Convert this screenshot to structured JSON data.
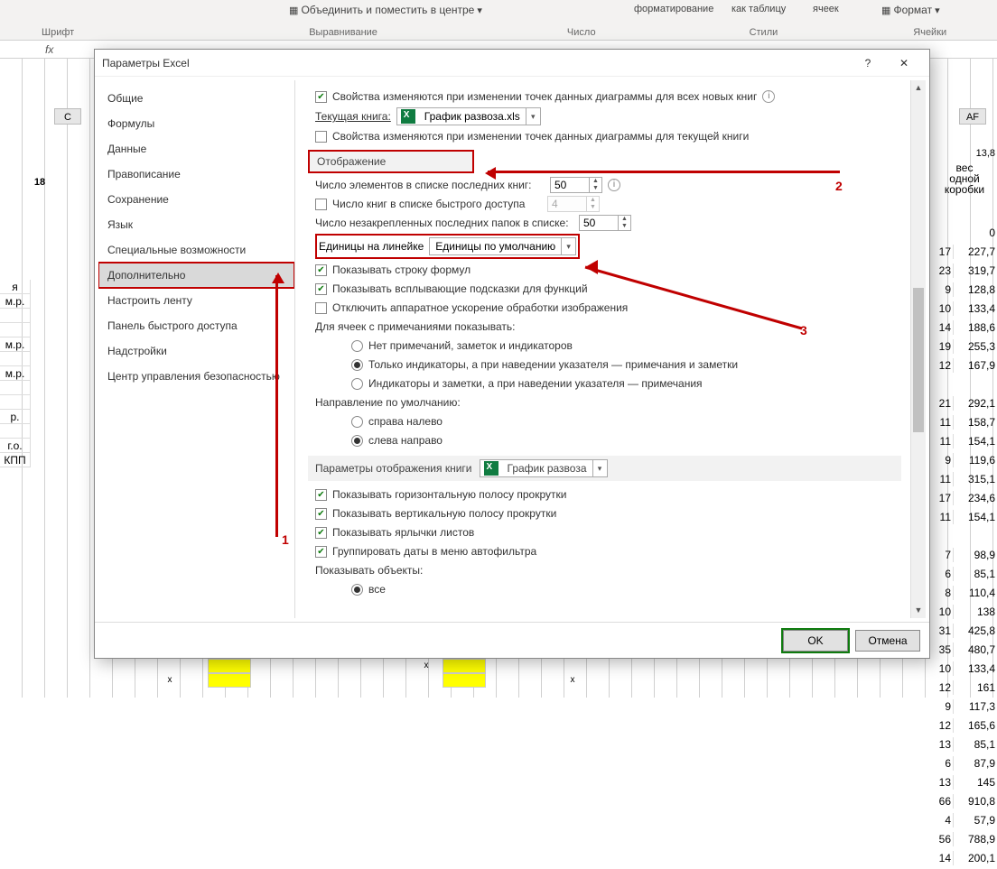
{
  "ribbon": {
    "merge_center": "Объединить и поместить в центре",
    "groups": [
      "Шрифт",
      "Выравнивание",
      "Число",
      "Стили",
      "Ячейки"
    ],
    "cond_format": "форматирование",
    "as_table": "как таблицу",
    "cells_style": "ячеек",
    "format": "Формат"
  },
  "formula_fx": "fx",
  "bg": {
    "col_c": "C",
    "col_af": "AF",
    "cell18": "18",
    "rhead1": "вес",
    "rhead2": "одной",
    "rhead3": "коробки",
    "topright": "13,8",
    "side_labels": [
      "я",
      "м.р.",
      "",
      "",
      "м.р.",
      "",
      "м.р.",
      "",
      "",
      "р.",
      "",
      "г.о.",
      "КПП"
    ],
    "side_x": [
      "x",
      "",
      "",
      "",
      "",
      "",
      "",
      "",
      "",
      "",
      "",
      "x",
      "",
      "x"
    ],
    "right_rows": [
      [
        "",
        "0"
      ],
      [
        "17",
        "227,7"
      ],
      [
        "23",
        "319,7"
      ],
      [
        "9",
        "128,8"
      ],
      [
        "10",
        "133,4"
      ],
      [
        "14",
        "188,6"
      ],
      [
        "19",
        "255,3"
      ],
      [
        "12",
        "167,9"
      ],
      [
        "",
        ""
      ],
      [
        "21",
        "292,1"
      ],
      [
        "11",
        "158,7"
      ],
      [
        "11",
        "154,1"
      ],
      [
        "9",
        "119,6"
      ],
      [
        "11",
        "315,1"
      ],
      [
        "17",
        "234,6"
      ],
      [
        "11",
        "154,1"
      ],
      [
        "",
        ""
      ],
      [
        "7",
        "98,9"
      ],
      [
        "6",
        "85,1"
      ],
      [
        "8",
        "110,4"
      ],
      [
        "10",
        "138"
      ],
      [
        "31",
        "425,8"
      ],
      [
        "35",
        "480,7"
      ],
      [
        "10",
        "133,4"
      ],
      [
        "12",
        "161"
      ],
      [
        "9",
        "117,3"
      ],
      [
        "12",
        "165,6"
      ],
      [
        "13",
        "85,1"
      ],
      [
        "6",
        "87,9"
      ],
      [
        "13",
        "145"
      ],
      [
        "66",
        "910,8"
      ],
      [
        "4",
        "57,9"
      ],
      [
        "56",
        "788,9"
      ],
      [
        "14",
        "200,1"
      ]
    ],
    "bottom_x": [
      "x",
      "x",
      "x"
    ]
  },
  "dialog": {
    "title": "Параметры Excel",
    "help": "?",
    "close": "✕",
    "nav": [
      "Общие",
      "Формулы",
      "Данные",
      "Правописание",
      "Сохранение",
      "Язык",
      "Специальные возможности",
      "Дополнительно",
      "Настроить ленту",
      "Панель быстрого доступа",
      "Надстройки",
      "Центр управления безопасностью"
    ],
    "nav_selected": "Дополнительно",
    "content": {
      "prop_all": "Свойства изменяются при изменении точек данных диаграммы для всех новых книг",
      "curbook_lbl": "Текущая книга:",
      "curbook_val": "График развоза.xls",
      "prop_cur": "Свойства изменяются при изменении точек данных диаграммы для текущей книги",
      "sect_display": "Отображение",
      "recent_docs_lbl": "Число элементов в списке последних книг:",
      "recent_docs_val": "50",
      "quick_books_lbl": "Число книг в списке быстрого доступа",
      "quick_books_val": "4",
      "unpinned_lbl": "Число незакрепленных последних папок в списке:",
      "unpinned_val": "50",
      "ruler_lbl": "Единицы на линейке",
      "ruler_val": "Единицы по умолчанию",
      "show_formula": "Показывать строку формул",
      "show_tooltips": "Показывать всплывающие подсказки для функций",
      "hw_accel": "Отключить аппаратное ускорение обработки изображения",
      "comments_head": "Для ячеек с примечаниями показывать:",
      "c_opt1": "Нет примечаний, заметок и индикаторов",
      "c_opt2": "Только индикаторы, а при наведении указателя — примечания и заметки",
      "c_opt3": "Индикаторы и заметки, а при наведении указателя — примечания",
      "dir_head": "Направление по умолчанию:",
      "d_opt1": "справа налево",
      "d_opt2": "слева направо",
      "sect_book_display": "Параметры отображения книги",
      "book_val": "График развоза",
      "hscroll": "Показывать горизонтальную полосу прокрутки",
      "vscroll": "Показывать вертикальную полосу прокрутки",
      "tabs": "Показывать ярлычки листов",
      "group_dates": "Группировать даты в меню автофильтра",
      "obj_head": "Показывать объекты:",
      "obj_all": "все"
    },
    "ok": "OK",
    "cancel": "Отмена"
  },
  "annotations": {
    "n1": "1",
    "n2": "2",
    "n3": "3"
  }
}
